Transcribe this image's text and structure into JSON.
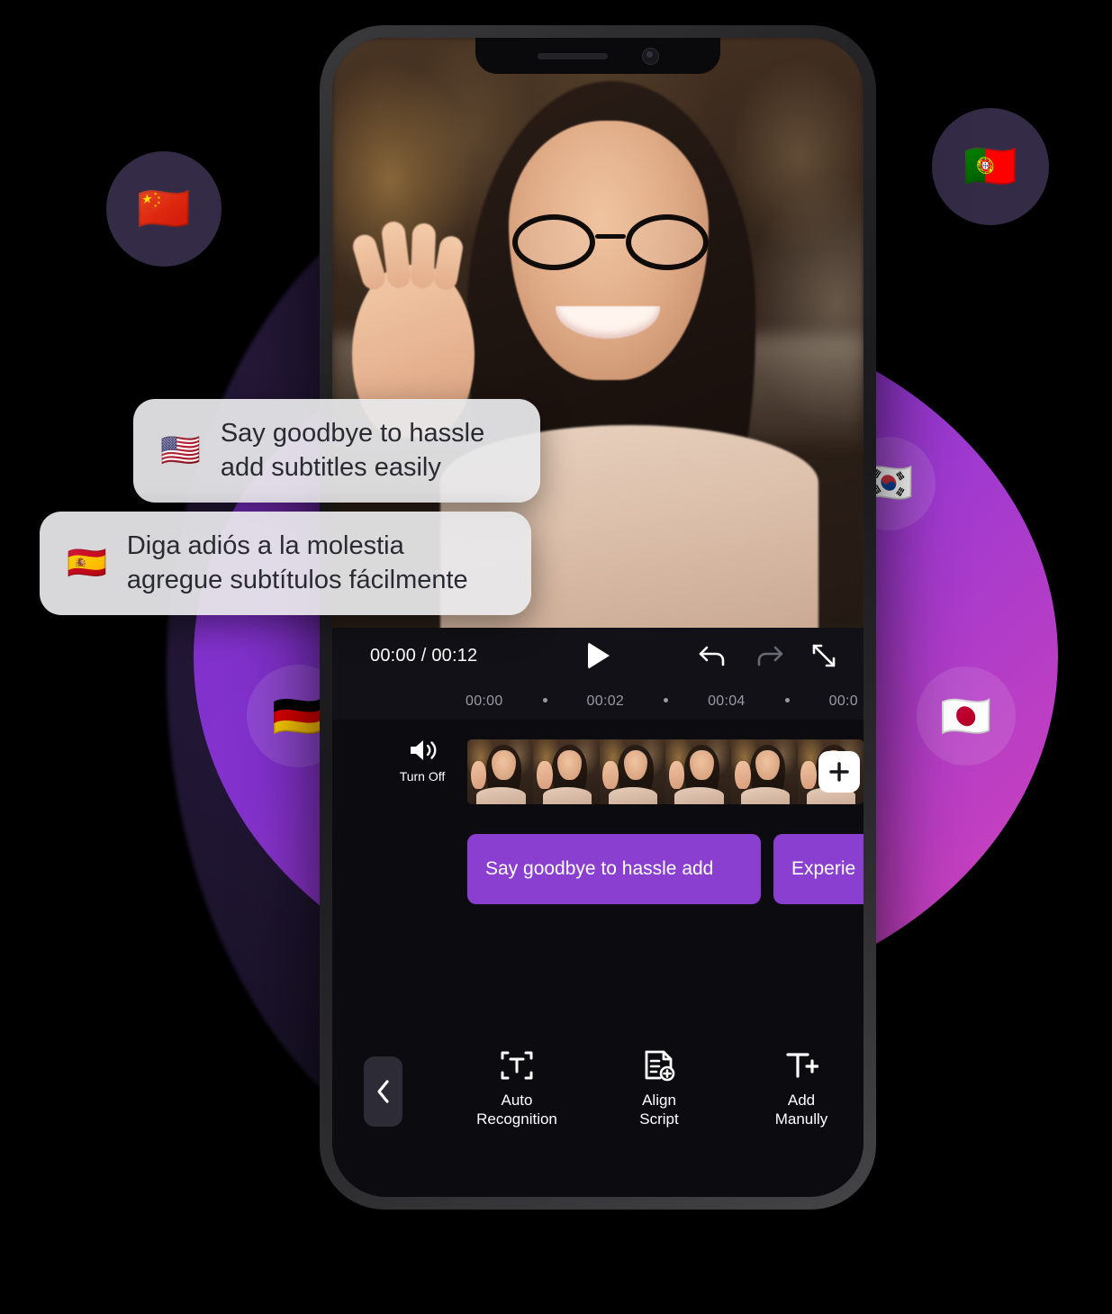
{
  "app": {
    "accent_purple": "#8a3fd1",
    "screen_bg": "#0c0b10"
  },
  "player": {
    "time_display": "00:00 / 00:12",
    "current_time": "00:00",
    "total_time": "00:12",
    "play_icon": "play-icon",
    "undo_icon": "undo-icon",
    "redo_icon": "redo-icon",
    "fullscreen_icon": "fullscreen-expand-icon"
  },
  "ruler": {
    "labels": [
      "00:00",
      "00:02",
      "00:04",
      "00:0"
    ],
    "dot": "•"
  },
  "timeline": {
    "audio_toggle": {
      "label": "Turn Off",
      "icon": "speaker-volume-icon"
    },
    "add_clip_icon": "plus-icon",
    "thumbnail_count": 6
  },
  "subtitle_clips": [
    {
      "label": "Say goodbye to hassle add"
    },
    {
      "label": "Experie"
    }
  ],
  "toolbar": {
    "back_icon": "chevron-left-icon",
    "items": [
      {
        "label": "Auto\nRecognition",
        "icon": "text-scan-icon"
      },
      {
        "label": "Align\nScript",
        "icon": "document-align-icon"
      },
      {
        "label": "Add\nManully",
        "icon": "text-add-icon"
      }
    ]
  },
  "bubbles": [
    {
      "flag": "🇺🇸",
      "flag_name": "flag-us",
      "text": "Say goodbye to hassle\nadd subtitles easily"
    },
    {
      "flag": "🇪🇸",
      "flag_name": "flag-es",
      "text": "Diga adiós a la molestia\nagregue subtítulos fácilmente"
    }
  ],
  "flag_badges": [
    {
      "flag": "🇨🇳",
      "name": "flag-cn"
    },
    {
      "flag": "🇵🇹",
      "name": "flag-pt"
    },
    {
      "flag": "🇰🇷",
      "name": "flag-kr"
    },
    {
      "flag": "🇯🇵",
      "name": "flag-jp"
    },
    {
      "flag": "🇩🇪",
      "name": "flag-de"
    }
  ]
}
